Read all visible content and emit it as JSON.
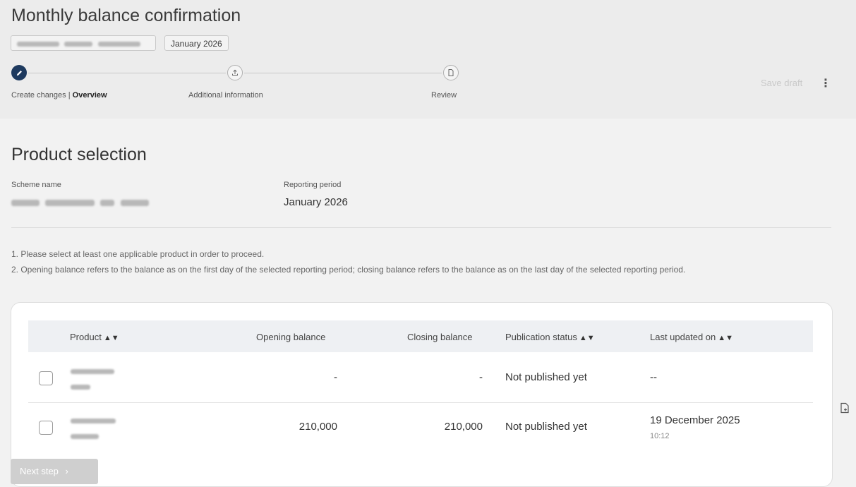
{
  "header": {
    "title": "Monthly balance confirmation",
    "period_chip": "January 2026",
    "save_draft": "Save draft",
    "more_icon": "kebab-menu-icon"
  },
  "stepper": {
    "steps": [
      {
        "label_prefix": "Create changes | ",
        "label_strong": "Overview",
        "icon": "pencil-icon",
        "state": "active"
      },
      {
        "label": "Additional information",
        "icon": "upload-icon",
        "state": "todo"
      },
      {
        "label": "Review",
        "icon": "document-icon",
        "state": "todo"
      }
    ]
  },
  "product_selection": {
    "title": "Product selection",
    "scheme_label": "Scheme name",
    "period_label": "Reporting period",
    "period_value": "January 2026",
    "notes": [
      "1. Please select at least one applicable product in order to proceed.",
      "2. Opening balance refers to the balance as on the first day of the selected reporting period; closing balance refers to the balance as on the last day of the selected reporting period."
    ]
  },
  "table": {
    "columns": [
      "Product",
      "Opening balance",
      "Closing balance",
      "Publication status",
      "Last updated on"
    ],
    "sortable_icon": "sort-icon",
    "rows": [
      {
        "opening": "-",
        "closing": "-",
        "status": "Not published yet",
        "updated": "--",
        "updated_time": ""
      },
      {
        "opening": "210,000",
        "closing": "210,000",
        "status": "Not published yet",
        "updated": "19 December 2025",
        "updated_time": "10:12"
      }
    ]
  },
  "footer": {
    "next_step": "Next step",
    "next_icon": "chevron-right-icon"
  },
  "side_tool_icon": "document-add-icon"
}
